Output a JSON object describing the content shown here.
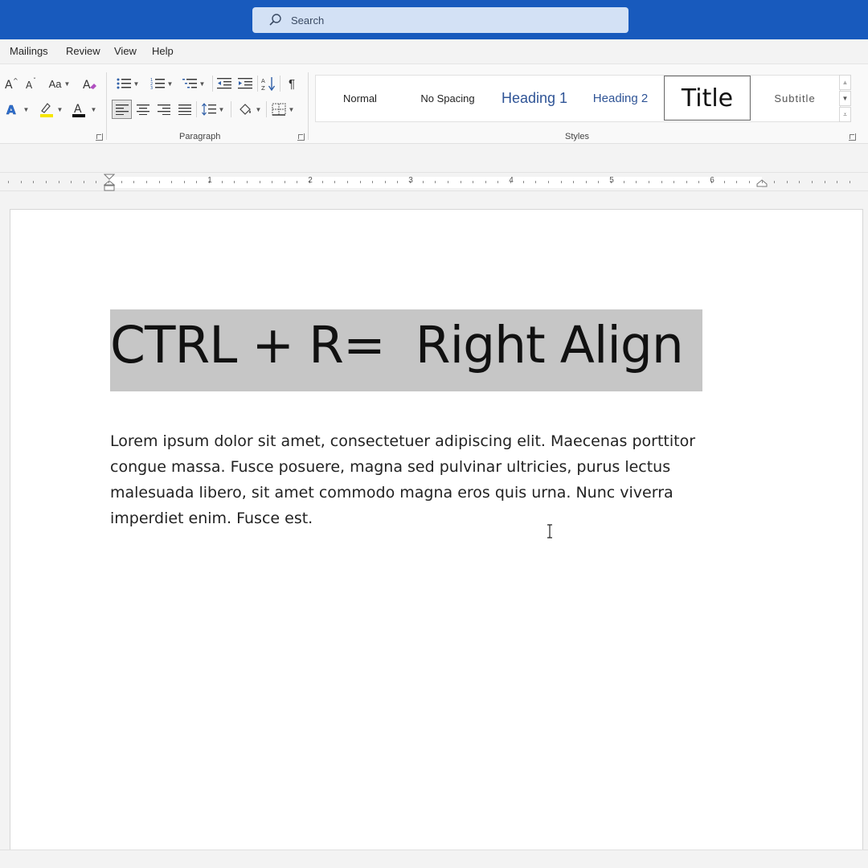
{
  "titlebar": {
    "search_placeholder": "Search"
  },
  "menu": {
    "tabs": [
      "Mailings",
      "Review",
      "View",
      "Help"
    ]
  },
  "ribbon": {
    "font_group": {
      "change_case_label": "Aa",
      "font_color_letter": "A"
    },
    "paragraph_group": {
      "label": "Paragraph",
      "pilcrow": "¶"
    },
    "styles_group": {
      "label": "Styles",
      "items": [
        {
          "label": "Normal"
        },
        {
          "label": "No Spacing"
        },
        {
          "label": "Heading 1"
        },
        {
          "label": "Heading 2"
        },
        {
          "label": "Title",
          "selected": true
        },
        {
          "label": "Subtitle"
        }
      ]
    }
  },
  "ruler": {
    "numbers": [
      "1",
      "2",
      "3",
      "4",
      "5",
      "6"
    ]
  },
  "document": {
    "title": "CTRL + R=  Right Align",
    "body": "Lorem ipsum dolor sit amet, consectetuer adipiscing elit. Maecenas porttitor congue massa. Fusce posuere, magna sed pulvinar ultricies, purus lectus malesuada libero, sit amet commodo magna eros quis urna. Nunc viverra imperdiet enim. Fusce est."
  },
  "colors": {
    "titlebar": "#185abd",
    "highlight_yellow": "#f6e600",
    "font_color_red": "#111111",
    "selection_gray": "#c6c6c6"
  }
}
